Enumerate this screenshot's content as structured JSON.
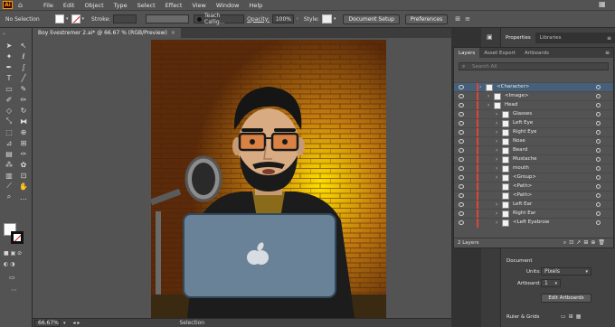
{
  "app": {
    "logo": "Ai"
  },
  "menu": [
    "File",
    "Edit",
    "Object",
    "Type",
    "Select",
    "Effect",
    "View",
    "Window",
    "Help"
  ],
  "control_bar": {
    "selection_label": "No Selection",
    "stroke_label": "Stroke:",
    "brush_value": "Teach Callig...",
    "opacity_label": "Opacity:",
    "opacity_value": "100%",
    "style_label": "Style:",
    "document_setup": "Document Setup",
    "preferences": "Preferences"
  },
  "document_tab": {
    "title": "Boy livestremer 2.ai* @ 66.67 % (RGB/Preview)",
    "close": "×"
  },
  "status_bar": {
    "zoom": "66.67%",
    "tool": "Selection"
  },
  "properties_tabs": [
    "Properties",
    "Libraries"
  ],
  "layers_panel": {
    "tabs": [
      "Layers",
      "Asset Export",
      "Artboards"
    ],
    "search_placeholder": "Search All",
    "rows": [
      {
        "name": "<Character>",
        "indent": 0,
        "selected": true
      },
      {
        "name": "<Image>",
        "indent": 1,
        "selected": false
      },
      {
        "name": "Head",
        "indent": 1,
        "selected": false
      },
      {
        "name": "Glasses",
        "indent": 2,
        "selected": false
      },
      {
        "name": "Left Eye",
        "indent": 2,
        "selected": false
      },
      {
        "name": "Right Eye",
        "indent": 2,
        "selected": false
      },
      {
        "name": "Nose",
        "indent": 2,
        "selected": false
      },
      {
        "name": "Beard",
        "indent": 2,
        "selected": false
      },
      {
        "name": "Mustache",
        "indent": 2,
        "selected": false
      },
      {
        "name": "mouth",
        "indent": 2,
        "selected": false
      },
      {
        "name": "<Group>",
        "indent": 2,
        "selected": false
      },
      {
        "name": "<Path>",
        "indent": 2,
        "selected": false
      },
      {
        "name": "<Path>",
        "indent": 2,
        "selected": false
      },
      {
        "name": "Left Ear",
        "indent": 2,
        "selected": false
      },
      {
        "name": "Right Ear",
        "indent": 2,
        "selected": false
      },
      {
        "name": "<Left Eyebrow",
        "indent": 2,
        "selected": false
      }
    ],
    "footer_count": "2 Layers"
  },
  "document_section": {
    "heading": "Document",
    "units_label": "Units:",
    "units_value": "Pixels",
    "artboard_label": "Artboard:",
    "artboard_value": "1",
    "edit_artboards": "Edit Artboards",
    "rulers_grids": "Ruler & Grids"
  },
  "colors": {
    "accent_selected": "#46607a",
    "layer_color": "#e0453a",
    "ui_bg": "#535353"
  }
}
